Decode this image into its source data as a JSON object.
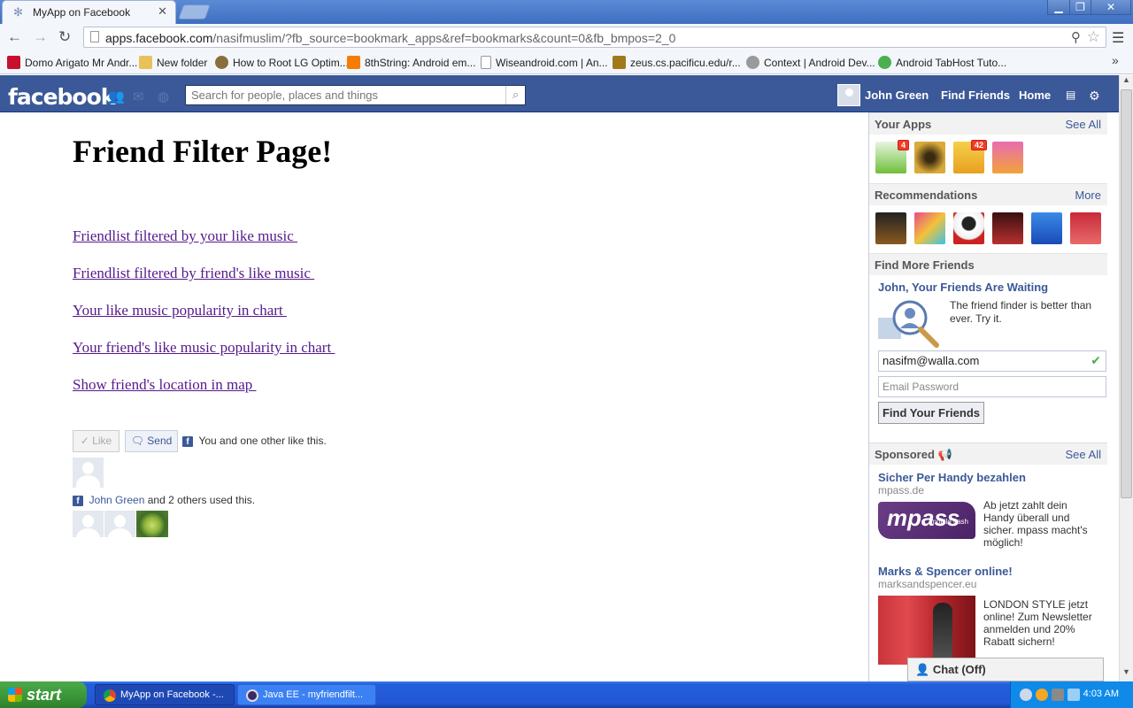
{
  "browser": {
    "tab_title": "MyApp on Facebook",
    "url_domain": "apps.facebook.com",
    "url_path": "/nasifmuslim/?fb_source=bookmark_apps&ref=bookmarks&count=0&fb_bmpos=2_0",
    "bookmarks": [
      {
        "label": "Domo Arigato Mr Andr...",
        "icon_color": "#c8102e"
      },
      {
        "label": "New folder",
        "icon_color": "#e8c15a"
      },
      {
        "label": "How to Root LG Optim...",
        "icon_color": "#8a6d3b"
      },
      {
        "label": "8thString: Android em...",
        "icon_color": "#f57d00"
      },
      {
        "label": "Wiseandroid.com | An...",
        "icon_color": "#ffffff"
      },
      {
        "label": "zeus.cs.pacificu.edu/r...",
        "icon_color": "#a07a1a"
      },
      {
        "label": "Context | Android Dev...",
        "icon_color": "#9a9a9a"
      },
      {
        "label": "Android TabHost Tuto...",
        "icon_color": "#4caf50"
      }
    ]
  },
  "facebook": {
    "logo": "facebook",
    "search_placeholder": "Search for people, places and things",
    "user_name": "John Green",
    "nav_find_friends": "Find Friends",
    "nav_home": "Home"
  },
  "main": {
    "title": "Friend Filter Page!",
    "links": [
      "Friendlist filtered by your like music ",
      "Friendlist filtered by friend's like music ",
      "Your like music popularity in chart ",
      "Your friend's like music popularity in chart ",
      "Show friend's location in map "
    ],
    "like_label": "Like",
    "send_label": "Send",
    "likes_text": "You and one other like this.",
    "used_name": "John Green",
    "used_text": " and 2 others used this."
  },
  "sidebar": {
    "your_apps": "Your Apps",
    "see_all": "See All",
    "app_badges": [
      "4",
      "",
      "42",
      ""
    ],
    "recommendations": "Recommendations",
    "more": "More",
    "find_more_friends": "Find More Friends",
    "finder_title": "John, Your Friends Are Waiting",
    "finder_text": "The friend finder is better than ever. Try it.",
    "email_value": "nasifm@walla.com",
    "password_placeholder": "Email Password",
    "find_button": "Find Your Friends",
    "sponsored": "Sponsored",
    "sponsored_see_all": "See All",
    "ads": [
      {
        "title": "Sicher Per Handy bezahlen",
        "domain": "mpass.de",
        "text": "Ab jetzt zahlt dein Handy überall und sicher. mpass macht's möglich!",
        "logo": "mpass",
        "logo_sub": "mobile cash"
      },
      {
        "title": "Marks & Spencer online!",
        "domain": "marksandspencer.eu",
        "text": "LONDON STYLE jetzt online! Zum Newsletter anmelden und 20% Rabatt sichern!"
      }
    ],
    "chat": "Chat (Off)"
  },
  "taskbar": {
    "start": "start",
    "tasks": [
      "MyApp on Facebook -...",
      "Java EE - myfriendfilt..."
    ],
    "clock": "4:03 AM"
  }
}
